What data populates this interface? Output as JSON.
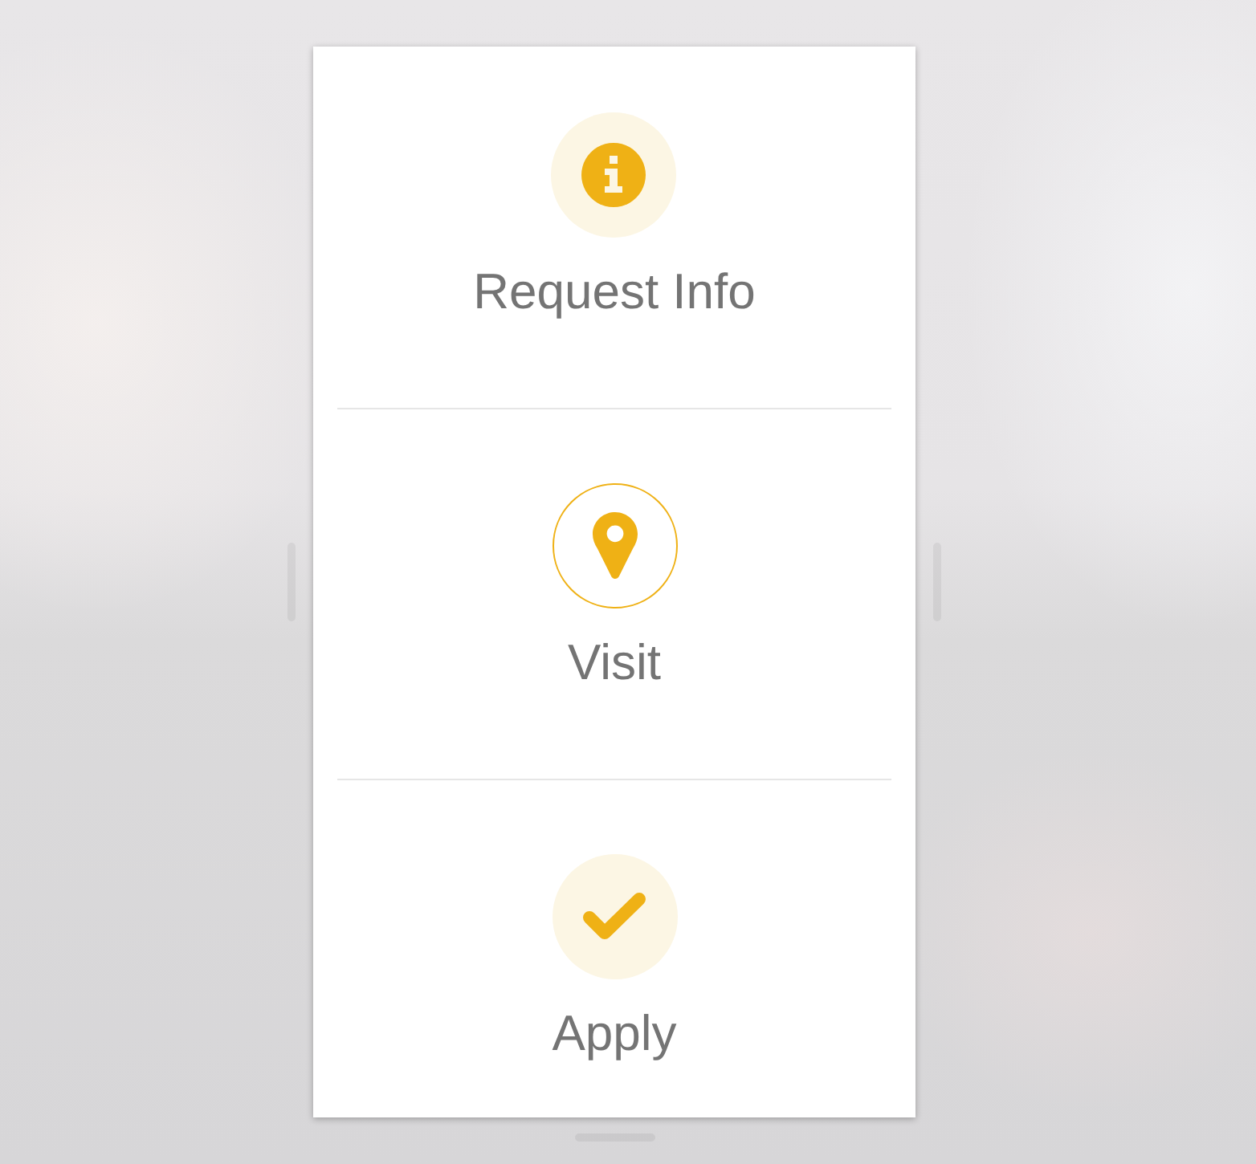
{
  "actions": [
    {
      "kind": "info",
      "label": "Request Info",
      "selected": false
    },
    {
      "kind": "pin",
      "label": "Visit",
      "selected": true
    },
    {
      "kind": "check",
      "label": "Apply",
      "selected": false
    }
  ]
}
